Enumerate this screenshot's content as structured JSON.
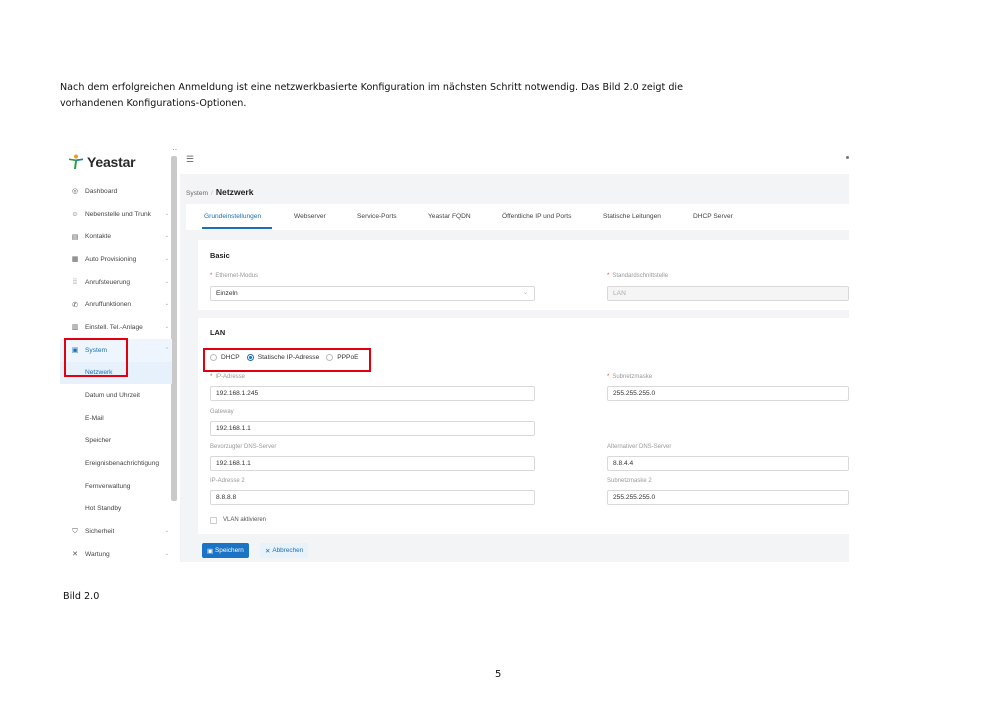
{
  "document": {
    "intro_line1": "Nach dem erfolgreichen Anmeldung ist eine netzwerkbasierte Konfiguration im nächsten Schritt notwendig. Das Bild 2.0 zeigt die",
    "intro_line2": "vorhandenen Konfigurations-Optionen.",
    "caption": "Bild 2.0",
    "page_number": "5"
  },
  "app": {
    "logo_text": "Yeastar",
    "sidebar": {
      "items": [
        {
          "label": "Dashboard",
          "icon": "dashboard-icon"
        },
        {
          "label": "Nebenstelle und Trunk",
          "icon": "users-icon"
        },
        {
          "label": "Kontakte",
          "icon": "contacts-icon"
        },
        {
          "label": "Auto Provisioning",
          "icon": "provisioning-icon"
        },
        {
          "label": "Anrufsteuerung",
          "icon": "call-control-icon"
        },
        {
          "label": "Anruffunktionen",
          "icon": "phone-icon"
        },
        {
          "label": "Einstell. Tel.-Anlage",
          "icon": "pbx-settings-icon"
        },
        {
          "label": "System",
          "icon": "system-icon"
        }
      ],
      "system_sub": [
        "Netzwerk",
        "Datum und Uhrzeit",
        "E-Mail",
        "Speicher",
        "Ereignisbenachrichtigung",
        "Fernverwaltung",
        "Hot Standby"
      ],
      "bottom_items": [
        {
          "label": "Sicherheit",
          "icon": "shield-icon"
        },
        {
          "label": "Wartung",
          "icon": "wrench-icon"
        }
      ]
    },
    "breadcrumb": {
      "parent": "System",
      "sep": "/",
      "current": "Netzwerk"
    },
    "tabs": [
      "Grundeinstellungen",
      "Webserver",
      "Service-Ports",
      "Yeastar FQDN",
      "Öffentliche IP und Ports",
      "Statische Leitungen",
      "DHCP Server"
    ],
    "basic": {
      "title": "Basic",
      "ethernet_label": "Ethernet-Modus",
      "ethernet_value": "Einzeln",
      "interface_label": "Standardschnittstelle",
      "interface_value": "LAN"
    },
    "lan": {
      "title": "LAN",
      "modes": [
        "DHCP",
        "Statische IP-Adresse",
        "PPPoE"
      ],
      "ip_label": "IP-Adresse",
      "ip_value": "192.168.1.245",
      "subnet_label": "Subnetzmaske",
      "subnet_value": "255.255.255.0",
      "gateway_label": "Gateway",
      "gateway_value": "192.168.1.1",
      "dns1_label": "Bevorzugter DNS-Server",
      "dns1_value": "192.168.1.1",
      "dns2_label": "Alternativer DNS-Server",
      "dns2_value": "8.8.4.4",
      "ip2_label": "IP-Adresse 2",
      "ip2_value": "8.8.8.8",
      "subnet2_label": "Subnetzmaske 2",
      "subnet2_value": "255.255.255.0",
      "vlan_label": "VLAN aktivieren"
    },
    "buttons": {
      "save": "Speichern",
      "cancel": "Abbrechen"
    },
    "colors": {
      "accent": "#1a6fb5",
      "highlight": "#e0000f"
    }
  }
}
